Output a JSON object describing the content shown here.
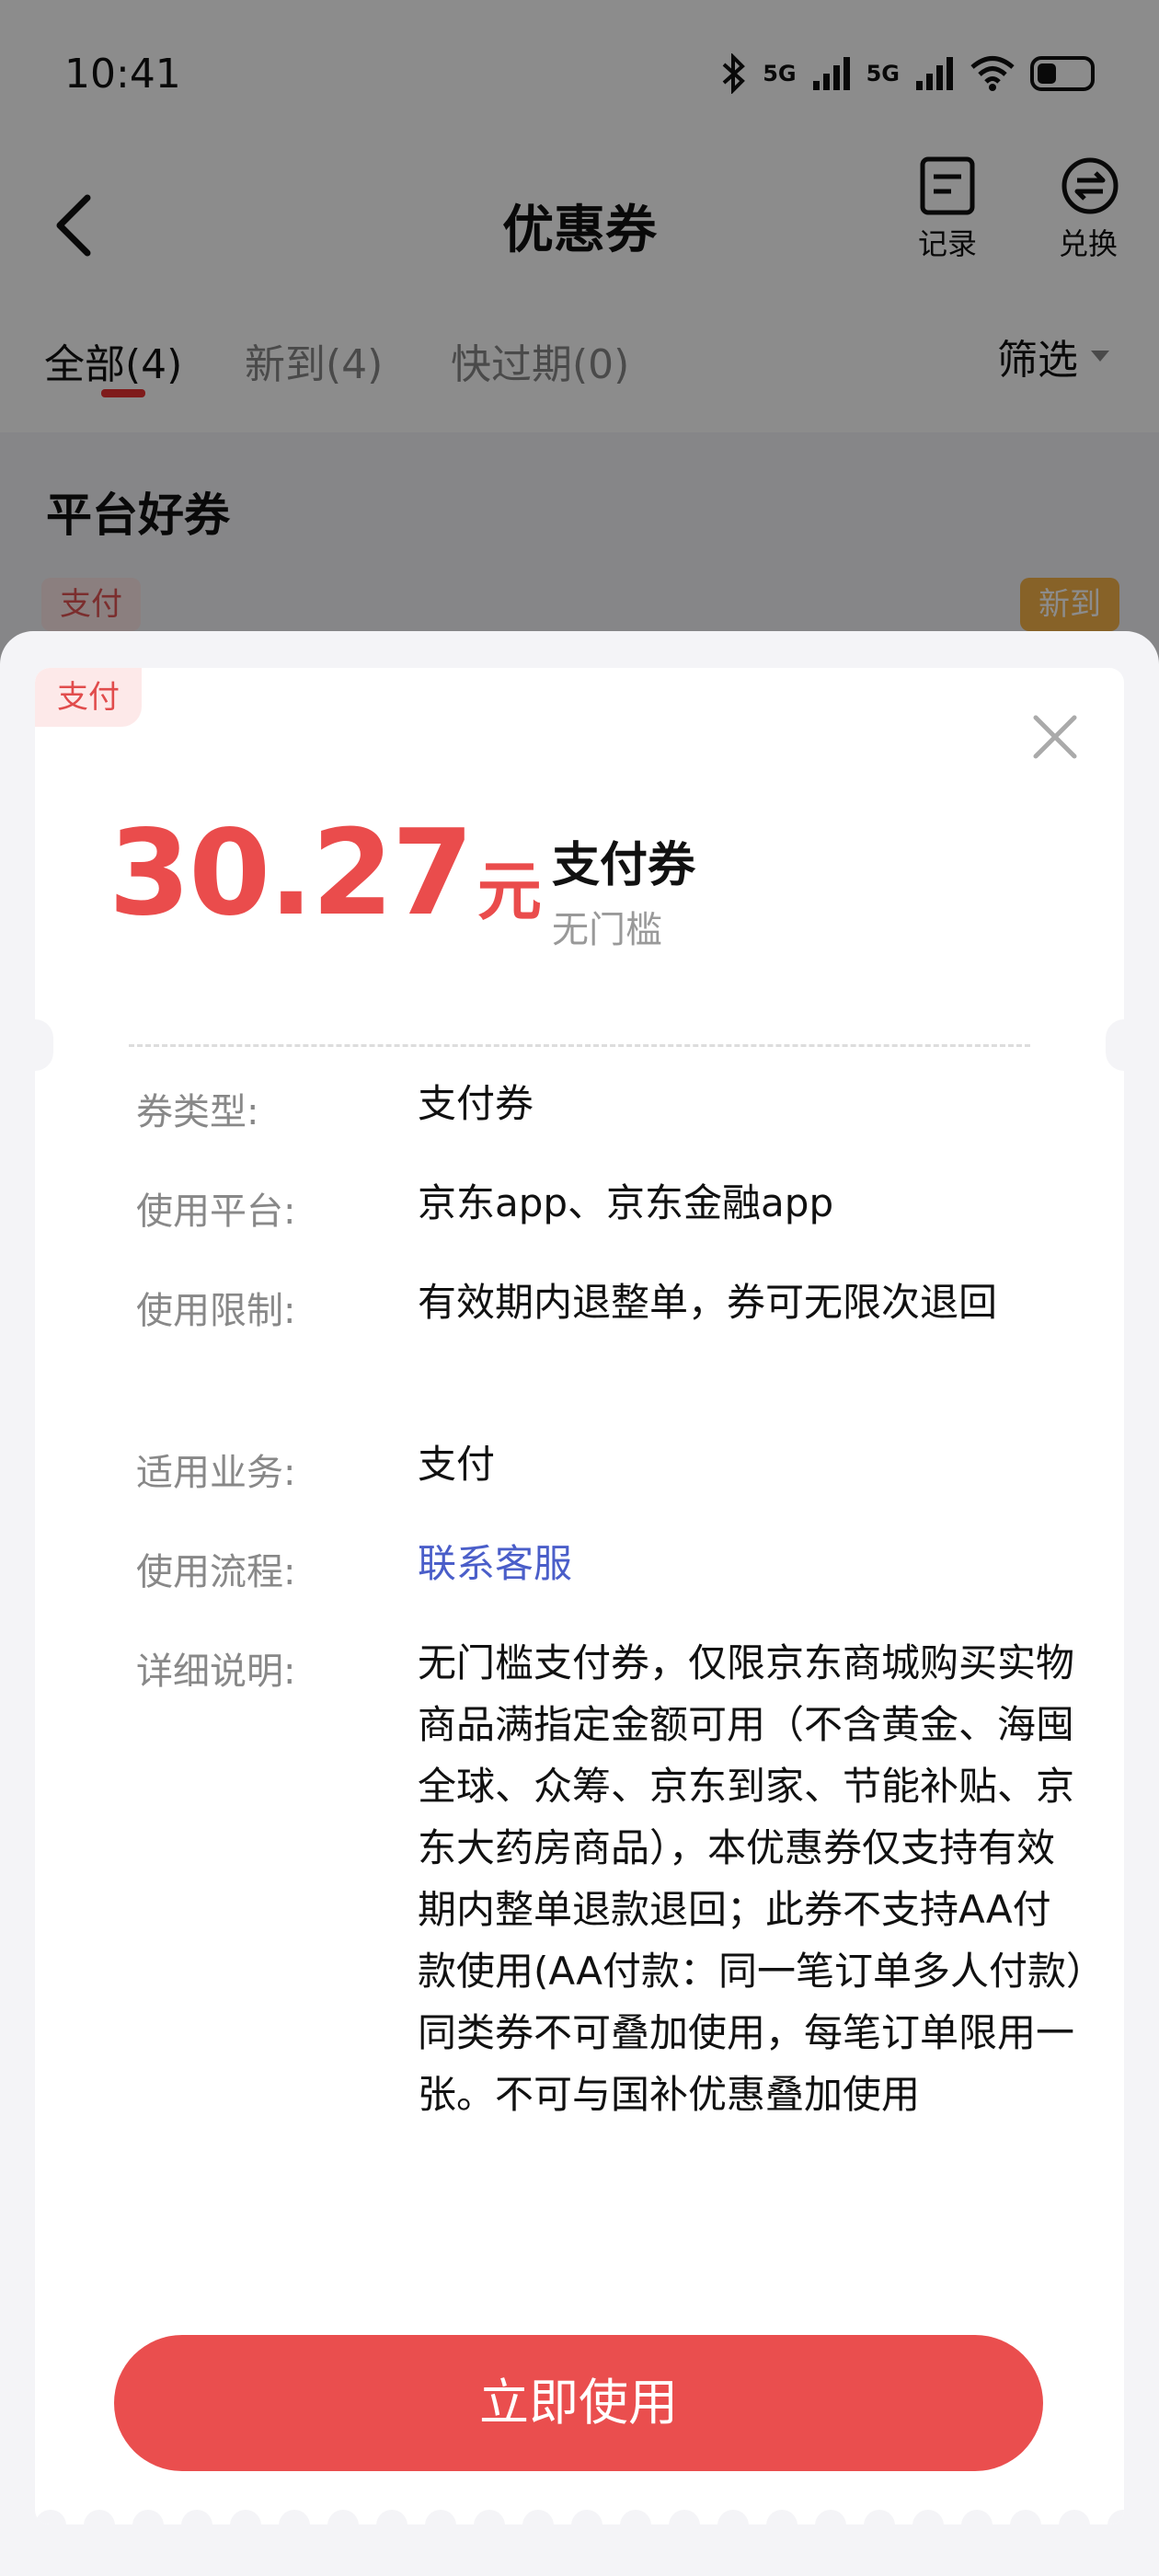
{
  "status_bar": {
    "time": "10:41",
    "net1": "5G",
    "net2": "5G"
  },
  "header": {
    "title": "优惠券",
    "record_label": "记录",
    "exchange_label": "兑换"
  },
  "tabs": [
    {
      "label": "全部(4)",
      "active": true
    },
    {
      "label": "新到(4)",
      "active": false
    },
    {
      "label": "快过期(0)",
      "active": false
    }
  ],
  "filter_label": "筛选",
  "section_title": "平台好券",
  "underlying_coupon": {
    "tag": "支付",
    "badge": "新到"
  },
  "colors": {
    "accent": "#ea4c4c",
    "link": "#4a5ec9",
    "tab_underline": "#e83232"
  },
  "sheet": {
    "corner_tag": "支付",
    "amount": "30.27",
    "unit": "元",
    "coupon_name": "支付券",
    "condition": "无门槛",
    "details": [
      {
        "label": "券类型:",
        "value": "支付券"
      },
      {
        "label": "使用平台:",
        "value": "京东app、京东金融app"
      },
      {
        "label": "使用限制:",
        "value": "有效期内退整单，券可无限次退回"
      },
      {
        "label": "适用业务:",
        "value": "支付"
      },
      {
        "label": "使用流程:",
        "value": "联系客服"
      },
      {
        "label": "详细说明:",
        "value": "无门槛支付券，仅限京东商城购买实物商品满指定金额可用（不含黄金、海囤全球、众筹、京东到家、节能补贴、京东大药房商品），本优惠券仅支持有效期内整单退款退回；此券不支持AA付款使用(AA付款：同一笔订单多人付款）同类券不可叠加使用，每笔订单限用一张。不可与国补优惠叠加使用"
      }
    ],
    "use_button": "立即使用"
  }
}
